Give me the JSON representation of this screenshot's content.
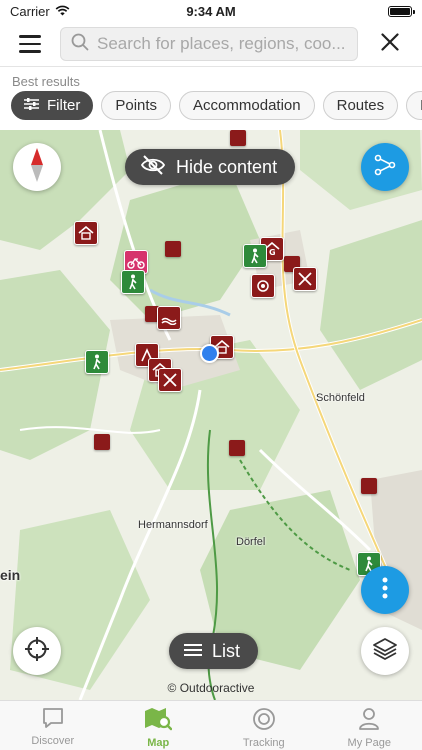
{
  "status_bar": {
    "carrier": "Carrier",
    "time": "9:34 AM"
  },
  "search": {
    "placeholder": "Search for places, regions, coo..."
  },
  "filter_area": {
    "heading": "Best results",
    "chips": [
      "Filter",
      "Points",
      "Accommodation",
      "Routes",
      "Eve"
    ]
  },
  "map": {
    "hide_content_label": "Hide content",
    "list_label": "List",
    "copyright": "© Outdooractive",
    "places": [
      "Schönfeld",
      "Hermannsdorf",
      "Dörfel",
      "ein"
    ]
  },
  "tabs": [
    {
      "label": "Discover",
      "icon": "discover-icon",
      "active": false
    },
    {
      "label": "Map",
      "icon": "map-icon",
      "active": true
    },
    {
      "label": "Tracking",
      "icon": "tracking-icon",
      "active": false
    },
    {
      "label": "My Page",
      "icon": "my-page-icon",
      "active": false
    }
  ],
  "colors": {
    "accent": "#1d9be3",
    "active_tab": "#7ab648",
    "poi": "#8b1a1a",
    "poi_green": "#2e8a3a"
  }
}
